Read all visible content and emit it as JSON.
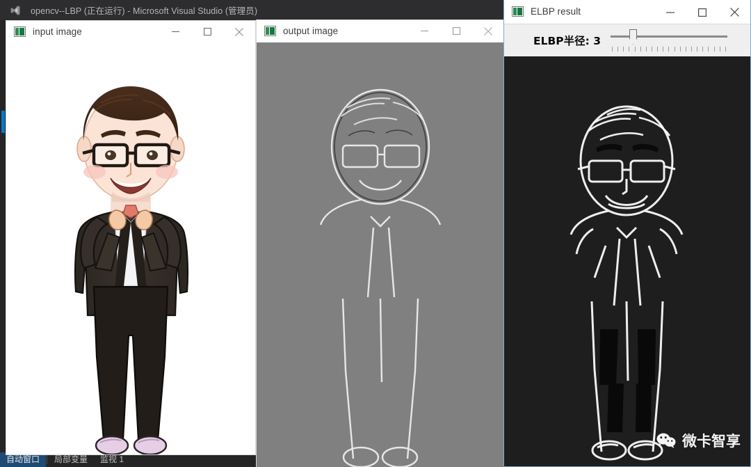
{
  "ide": {
    "title": "opencv--LBP (正在运行) - Microsoft Visual Studio (管理员)",
    "logo_icon": "visual-studio-logo-icon",
    "bottom_tabs": [
      {
        "label": "自动窗口",
        "active": true
      },
      {
        "label": "局部变量",
        "active": false
      },
      {
        "label": "监视 1",
        "active": false
      }
    ]
  },
  "windows": {
    "input": {
      "title": "input image",
      "icon": "opencv-window-icon",
      "minimize_label": "最小化",
      "maximize_label": "最大化",
      "close_label": "关闭",
      "content_description": "cartoon-avatar-man-with-glasses-suit"
    },
    "output": {
      "title": "output image",
      "icon": "opencv-window-icon",
      "minimize_label": "最小化",
      "maximize_label": "最大化",
      "close_label": "关闭",
      "content_description": "lbp-texture-grayscale-result"
    },
    "elbp": {
      "title": "ELBP result",
      "icon": "opencv-window-icon",
      "minimize_label": "最小化",
      "maximize_label": "最大化",
      "close_label": "关闭",
      "content_description": "elbp-binary-edge-result",
      "trackbar": {
        "label": "ELBP半径: 3",
        "name": "ELBP半径",
        "value": 3,
        "min": 1,
        "max": 20,
        "tick_count": 21
      }
    }
  },
  "watermark": {
    "text": "微卡智享",
    "icon": "wechat-logo-icon"
  },
  "colors": {
    "vs_chrome": "#2d2d30",
    "vs_panel": "#252526",
    "vs_accent": "#007acc",
    "vs_tab_active": "#1e4b73",
    "window_chrome": "#ffffff",
    "output_background": "#808080",
    "elbp_background": "#1e1e1e",
    "elbp_border": "#8aa9c4",
    "toolbar_background": "#efefef"
  }
}
